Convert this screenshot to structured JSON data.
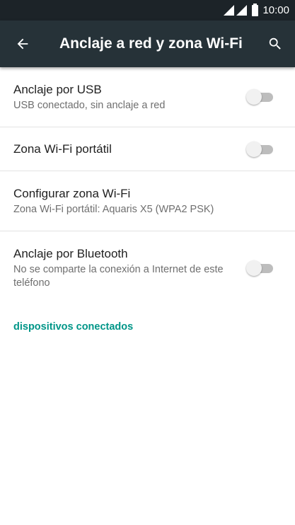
{
  "status_bar": {
    "time": "10:00"
  },
  "app_bar": {
    "title": "Anclaje a red y zona Wi-Fi"
  },
  "items": [
    {
      "title": "Anclaje por USB",
      "subtitle": "USB conectado, sin anclaje a red",
      "toggle": false
    },
    {
      "title": "Zona Wi-Fi portátil",
      "toggle": false
    },
    {
      "title": "Configurar zona Wi-Fi",
      "subtitle": "Zona Wi-Fi portátil: Aquaris X5 (WPA2 PSK)"
    },
    {
      "title": "Anclaje por Bluetooth",
      "subtitle": "No se comparte la conexión a Internet de este teléfono",
      "toggle": false
    }
  ],
  "section_header": "dispositivos conectados",
  "colors": {
    "app_bar": "#263238",
    "status_bar": "#1c2328",
    "accent": "#009688"
  }
}
